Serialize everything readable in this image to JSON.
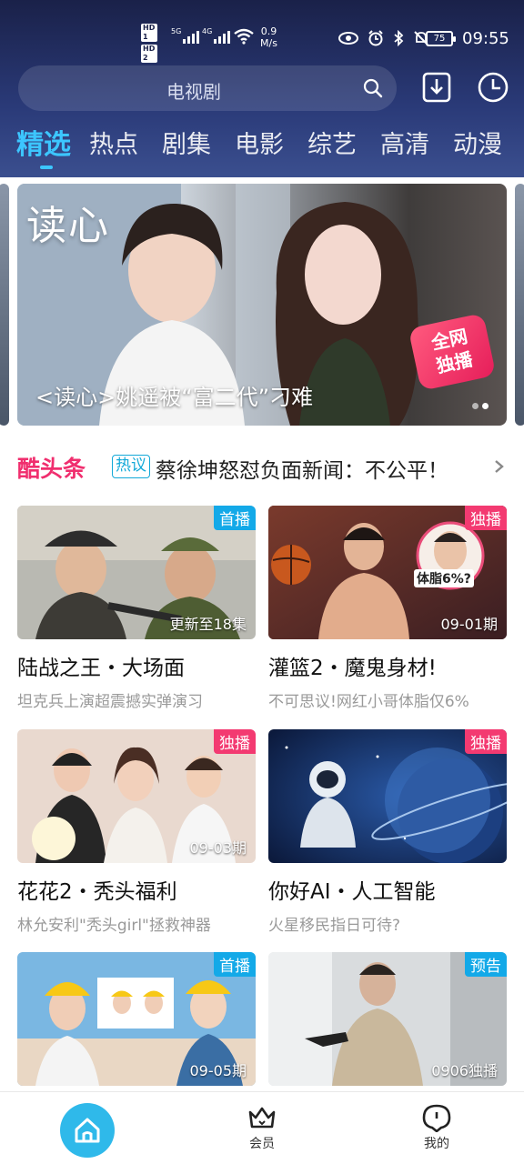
{
  "status_bar": {
    "hd1": "HD 1",
    "hd2": "HD 2",
    "sig1": "5G",
    "sig2": "4G",
    "net_speed_value": "0.9",
    "net_speed_unit": "M/s",
    "battery": "75",
    "time": "09:55"
  },
  "search": {
    "placeholder": "电视剧"
  },
  "tabs": [
    "精选",
    "热点",
    "剧集",
    "电影",
    "综艺",
    "高清",
    "动漫"
  ],
  "banner": {
    "logo": "读心",
    "caption": "<读心>姚遥被“富二代”刁难",
    "badge_line1": "全网",
    "badge_line2": "独播"
  },
  "news": {
    "logo": "酷头条",
    "tag": "热议",
    "text": "蔡徐坤怒怼负面新闻：不公平！"
  },
  "cards": [
    {
      "badge": "首播",
      "badge_color": "#13a9e8",
      "info": "更新至18集",
      "title": "陆战之王・大场面",
      "subtitle": "坦克兵上演超震撼实弹演习"
    },
    {
      "badge": "独播",
      "badge_color": "#f33a71",
      "info": "09-01期",
      "title": "灌篮2・魔鬼身材!",
      "subtitle": "不可思议!网红小哥体脂仅6%",
      "overlay": "体脂6%?"
    },
    {
      "badge": "独播",
      "badge_color": "#f33a71",
      "info": "09-03期",
      "title": "花花2・秃头福利",
      "subtitle": "林允安利\"秃头girl\"拯救神器"
    },
    {
      "badge": "独播",
      "badge_color": "#f33a71",
      "info": "",
      "title": "你好AI・人工智能",
      "subtitle": "火星移民指日可待?"
    },
    {
      "badge": "首播",
      "badge_color": "#13a9e8",
      "info": "09-05期",
      "title": "",
      "subtitle": ""
    },
    {
      "badge": "预告",
      "badge_color": "#13a9e8",
      "info": "0906独播",
      "title": "",
      "subtitle": ""
    }
  ],
  "bottom_nav": {
    "home": "home-icon",
    "vip_label": "会员",
    "mine_label": "我的"
  }
}
